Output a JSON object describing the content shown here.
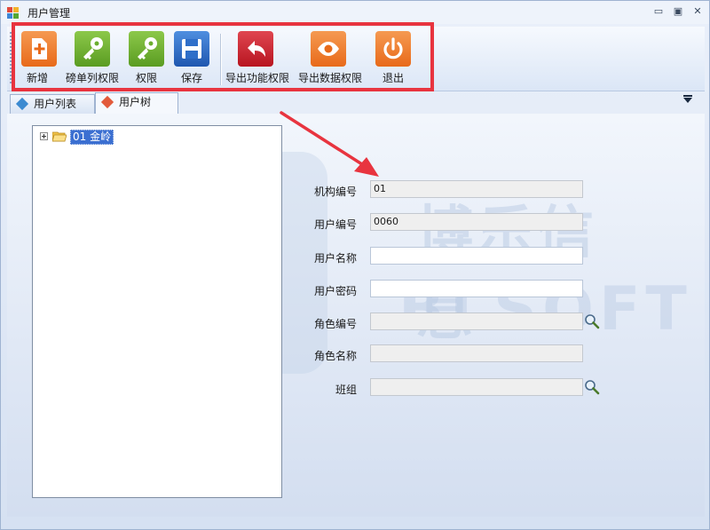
{
  "window": {
    "title": "用户管理",
    "minimize_glyph": "▭",
    "maximize_glyph": "▣",
    "close_glyph": "✕"
  },
  "toolbar": {
    "buttons": [
      {
        "label": "新增",
        "icon": "add-document-icon",
        "color": "#f07a28"
      },
      {
        "label": "磅单列权限",
        "icon": "key-icon",
        "color": "#6aae2e"
      },
      {
        "label": "权限",
        "icon": "key-icon",
        "color": "#6aae2e"
      },
      {
        "label": "保存",
        "icon": "floppy-disk-icon",
        "color": "#2f6fc9"
      },
      {
        "label": "导出功能权限",
        "icon": "undo-arrow-icon",
        "color": "#d2232e"
      },
      {
        "label": "导出数据权限",
        "icon": "eye-icon",
        "color": "#f07a28"
      },
      {
        "label": "退出",
        "icon": "power-icon",
        "color": "#f07a28"
      }
    ]
  },
  "tabs": [
    {
      "label": "用户列表",
      "active": false
    },
    {
      "label": "用户树",
      "active": true
    }
  ],
  "tree": {
    "nodes": [
      {
        "label": "01  金岭",
        "selected": true,
        "expanded": false
      }
    ]
  },
  "form": {
    "fields": [
      {
        "label": "机构编号",
        "value": "01",
        "editable": false
      },
      {
        "label": "用户编号",
        "value": "0060",
        "editable": false
      },
      {
        "label": "用户名称",
        "value": "",
        "editable": true
      },
      {
        "label": "用户密码",
        "value": "",
        "editable": true
      },
      {
        "label": "角色编号",
        "value": "",
        "editable": false,
        "lookup": true
      },
      {
        "label": "角色名称",
        "value": "",
        "editable": false
      },
      {
        "label": "班组",
        "value": "",
        "editable": false,
        "lookup": true
      }
    ]
  },
  "watermark": {
    "text_cn": "博乐信息",
    "text_en": "BLSOFT"
  },
  "annotation": {
    "highlight_color": "#e8343f"
  }
}
